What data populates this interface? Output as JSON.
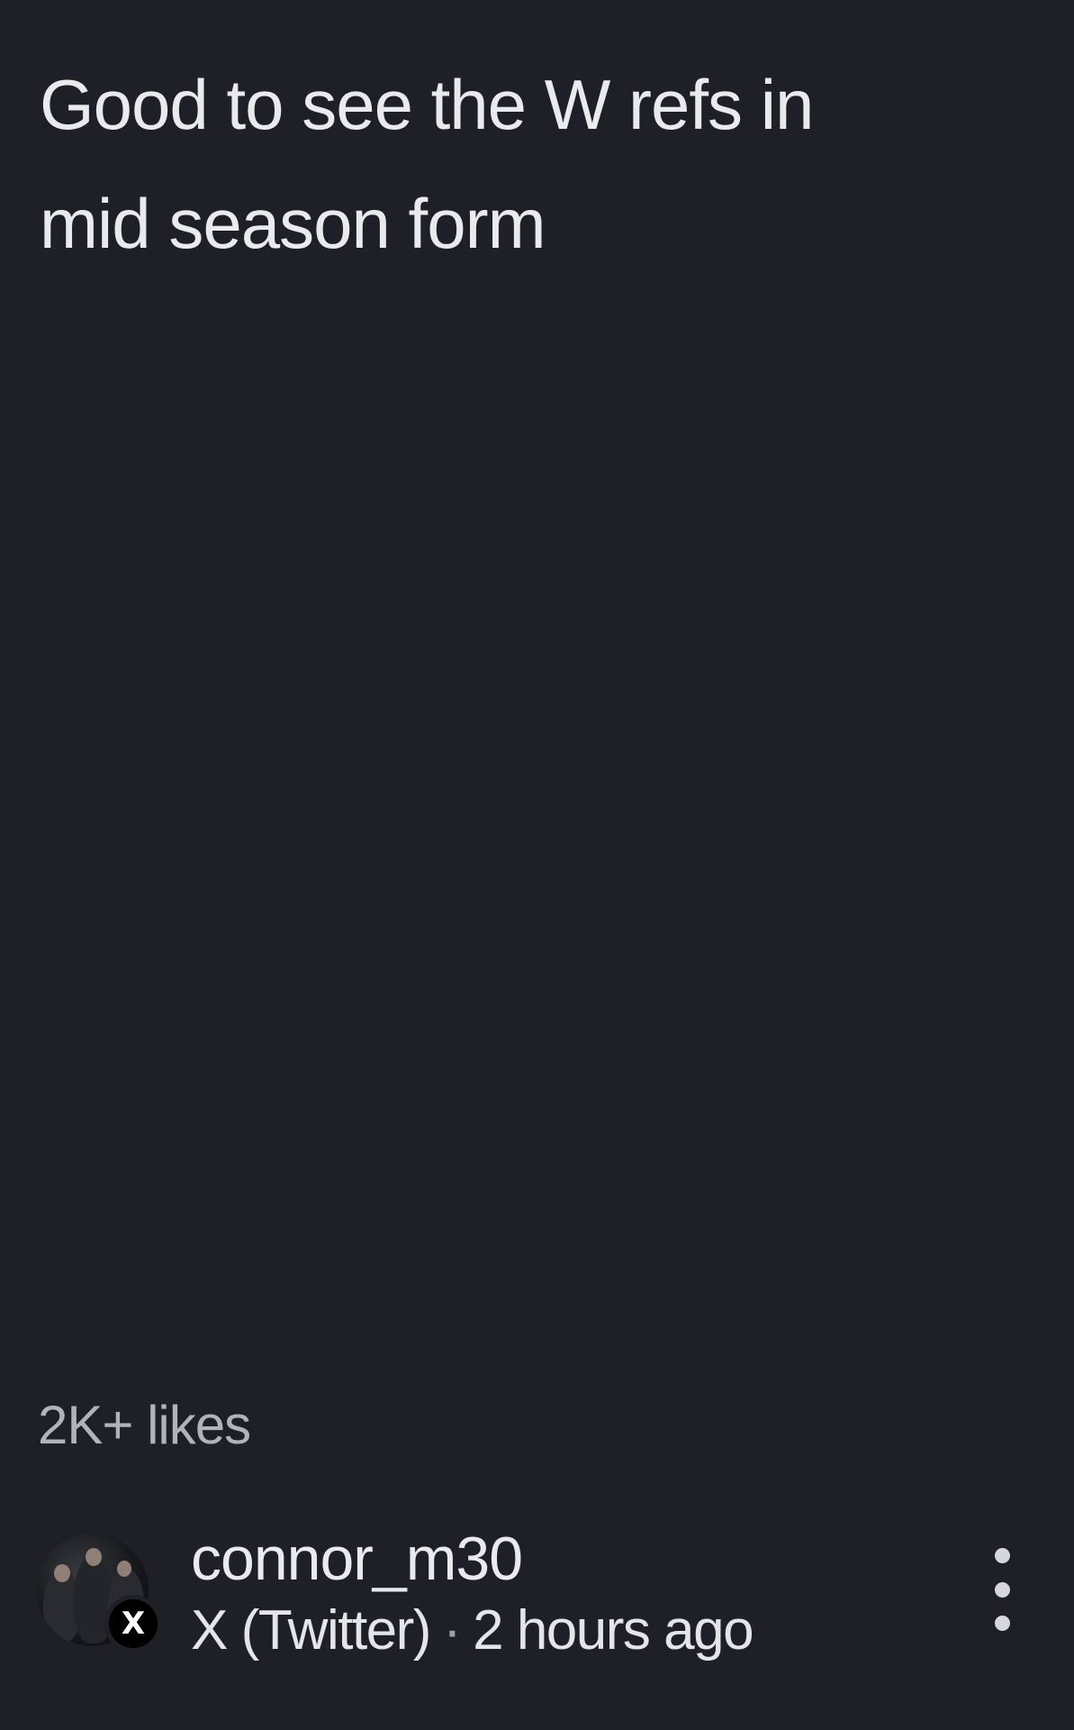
{
  "post": {
    "text_line1": "Good to see the W refs in",
    "text_line2": "mid season form",
    "likes": "2K+ likes"
  },
  "author": {
    "username": "connor_m30",
    "source": "X (Twitter)",
    "separator": "·",
    "time_ago": "2 hours ago",
    "source_badge_glyph": "X"
  },
  "icons": {
    "source_badge": "x-twitter-icon",
    "more": "more-vertical-icon"
  },
  "colors": {
    "background": "#1f2027",
    "text_primary": "#e8eaed",
    "text_secondary": "#b0b3b8"
  }
}
